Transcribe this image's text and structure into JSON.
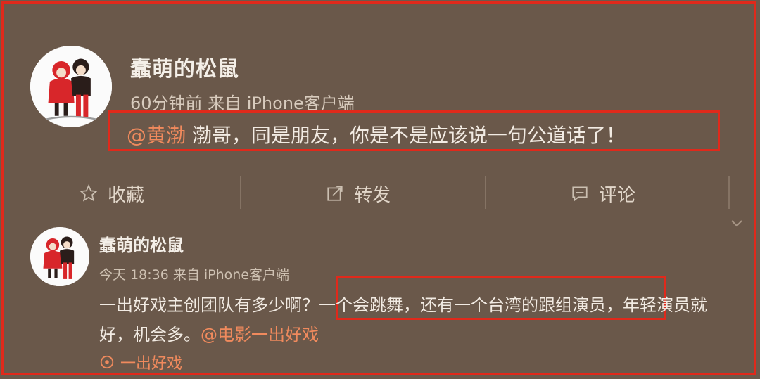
{
  "post": {
    "username": "蠢萌的松鼠",
    "meta": "60分钟前 来自 iPhone客户端",
    "mention": "@黄渤",
    "text": " 渤哥，同是朋友，你是不是应该说一句公道话了！"
  },
  "actions": {
    "favorite": "收藏",
    "repost": "转发",
    "comment": "评论"
  },
  "comment": {
    "username": "蠢萌的松鼠",
    "meta": "今天 18:36 来自 iPhone客户端",
    "line1": "一出好戏主创团队有多少啊？一个会跳舞，还有一个台湾的跟组演员，年轻演员就",
    "line2_prefix": "好，机会多。",
    "line2_mention": "@电影一出好戏",
    "topic": "一出好戏"
  },
  "colors": {
    "background": "#6a584a",
    "highlight_border": "#e0291b",
    "mention": "#f08a5d"
  },
  "icons": [
    "avatar-illustration",
    "star-icon",
    "repost-icon",
    "comment-icon",
    "chevron-down-icon",
    "location-icon"
  ]
}
